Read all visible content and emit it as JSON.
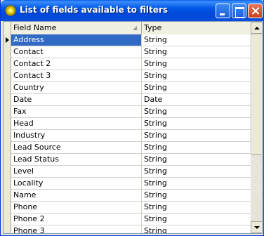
{
  "window": {
    "title": "List of fields available to filters"
  },
  "grid": {
    "columns": [
      "Field Name",
      "Type"
    ],
    "sort_column": "Field Name",
    "sort_direction": "ascending",
    "selected_index": 0,
    "rows": [
      {
        "name": "Address",
        "type": "String"
      },
      {
        "name": "Contact",
        "type": "String"
      },
      {
        "name": "Contact 2",
        "type": "String"
      },
      {
        "name": "Contact 3",
        "type": "String"
      },
      {
        "name": "Country",
        "type": "String"
      },
      {
        "name": "Date",
        "type": "Date"
      },
      {
        "name": "Fax",
        "type": "String"
      },
      {
        "name": "Head",
        "type": "String"
      },
      {
        "name": "Industry",
        "type": "String"
      },
      {
        "name": "Lead Source",
        "type": "String"
      },
      {
        "name": "Lead Status",
        "type": "String"
      },
      {
        "name": "Level",
        "type": "String"
      },
      {
        "name": "Locality",
        "type": "String"
      },
      {
        "name": "Name",
        "type": "String"
      },
      {
        "name": "Phone",
        "type": "String"
      },
      {
        "name": "Phone 2",
        "type": "String"
      },
      {
        "name": "Phone 3",
        "type": "String"
      }
    ]
  },
  "icons": {
    "app": "app-icon",
    "minimize": "minimize-icon",
    "maximize": "maximize-icon",
    "close": "close-icon",
    "row_indicator": "row-pointer-icon",
    "sort": "sort-arrow-icon"
  },
  "colors": {
    "titlebar": "#0055e5",
    "selection": "#316ac5",
    "close_button": "#c7401d"
  }
}
